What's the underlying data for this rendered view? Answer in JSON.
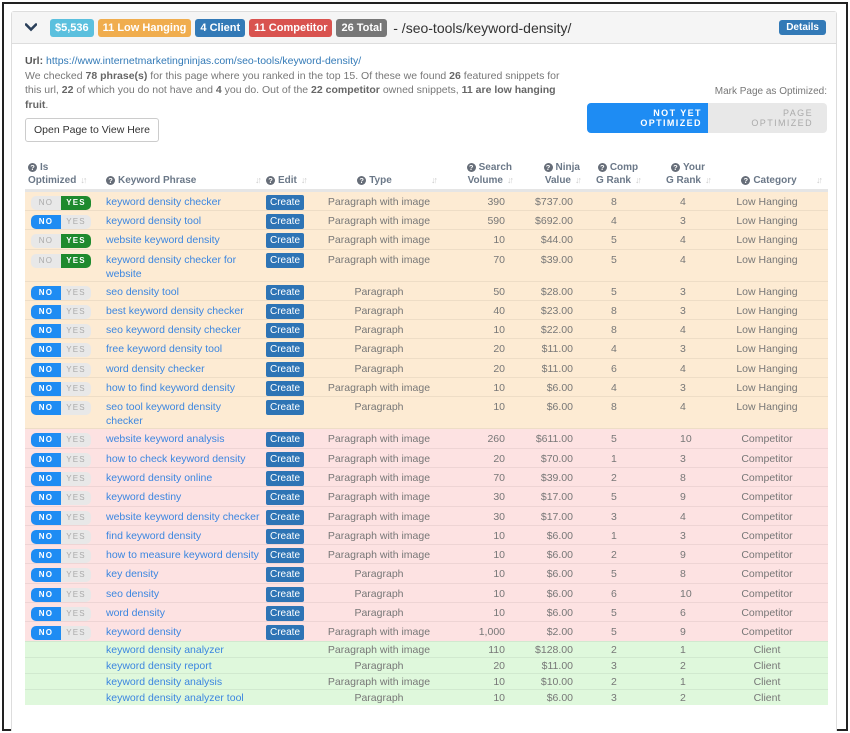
{
  "header": {
    "badges": {
      "value": "$5,536",
      "low_hanging": "11 Low Hanging",
      "client": "4 Client",
      "competitor": "11 Competitor",
      "total": "26 Total"
    },
    "path": "- /seo-tools/keyword-density/",
    "details_label": "Details"
  },
  "info": {
    "url_label": "Url:",
    "url": "https://www.internetmarketingninjas.com/seo-tools/keyword-density/",
    "text_1": "We checked ",
    "phrases": "78 phrase(s)",
    "text_2": " for this page where you ranked in the top 15. Of these we found ",
    "found": "26",
    "text_3": " featured snippets for this url, ",
    "not_have": "22",
    "text_4": " of which you do not have and ",
    "have": "4",
    "text_5": " you do. Out of the ",
    "competitor": "22 competitor",
    "text_6": " owned snippets, ",
    "low": "11 are low hanging fruit",
    "text_7": ".",
    "open_button": "Open Page to View Here"
  },
  "mark": {
    "label": "Mark Page as Optimized:",
    "not_yet": "NOT YET OPTIMIZED",
    "optimized": "PAGE OPTIMIZED",
    "selected": "NOT YET OPTIMIZED"
  },
  "table": {
    "headers": {
      "optimized_1": "Is",
      "optimized_2": "Optimized",
      "phrase": "Keyword Phrase",
      "edit": "Edit",
      "type": "Type",
      "volume_1": "Search",
      "volume_2": "Volume",
      "value_1": "Ninja",
      "value_2": "Value",
      "comp_1": "Comp",
      "comp_2": "G Rank",
      "your_1": "Your",
      "your_2": "G Rank",
      "category": "Category"
    },
    "toggle_labels": {
      "no": "NO",
      "yes": "YES"
    },
    "create_label": "Create",
    "rows": [
      {
        "opt": "yes",
        "phrase": "keyword density checker",
        "type": "Paragraph with image",
        "volume": "390",
        "value": "$737.00",
        "comp": "8",
        "your": "4",
        "category": "Low Hanging",
        "group": "low"
      },
      {
        "opt": "no",
        "phrase": "keyword density tool",
        "type": "Paragraph with image",
        "volume": "590",
        "value": "$692.00",
        "comp": "4",
        "your": "3",
        "category": "Low Hanging",
        "group": "low"
      },
      {
        "opt": "yes",
        "phrase": "website keyword density",
        "type": "Paragraph with image",
        "volume": "10",
        "value": "$44.00",
        "comp": "5",
        "your": "4",
        "category": "Low Hanging",
        "group": "low"
      },
      {
        "opt": "yes",
        "phrase": "keyword density checker for website",
        "type": "Paragraph with image",
        "volume": "70",
        "value": "$39.00",
        "comp": "5",
        "your": "4",
        "category": "Low Hanging",
        "group": "low"
      },
      {
        "opt": "no",
        "phrase": "seo density tool",
        "type": "Paragraph",
        "volume": "50",
        "value": "$28.00",
        "comp": "5",
        "your": "3",
        "category": "Low Hanging",
        "group": "low"
      },
      {
        "opt": "no",
        "phrase": "best keyword density checker",
        "type": "Paragraph",
        "volume": "40",
        "value": "$23.00",
        "comp": "8",
        "your": "3",
        "category": "Low Hanging",
        "group": "low"
      },
      {
        "opt": "no",
        "phrase": "seo keyword density checker",
        "type": "Paragraph",
        "volume": "10",
        "value": "$22.00",
        "comp": "8",
        "your": "4",
        "category": "Low Hanging",
        "group": "low"
      },
      {
        "opt": "no",
        "phrase": "free keyword density tool",
        "type": "Paragraph",
        "volume": "20",
        "value": "$11.00",
        "comp": "4",
        "your": "3",
        "category": "Low Hanging",
        "group": "low"
      },
      {
        "opt": "no",
        "phrase": "word density checker",
        "type": "Paragraph",
        "volume": "20",
        "value": "$11.00",
        "comp": "6",
        "your": "4",
        "category": "Low Hanging",
        "group": "low"
      },
      {
        "opt": "no",
        "phrase": "how to find keyword density",
        "type": "Paragraph with image",
        "volume": "10",
        "value": "$6.00",
        "comp": "4",
        "your": "3",
        "category": "Low Hanging",
        "group": "low"
      },
      {
        "opt": "no",
        "phrase": "seo tool keyword density checker",
        "type": "Paragraph",
        "volume": "10",
        "value": "$6.00",
        "comp": "8",
        "your": "4",
        "category": "Low Hanging",
        "group": "low"
      },
      {
        "opt": "no",
        "phrase": "website keyword analysis",
        "type": "Paragraph with image",
        "volume": "260",
        "value": "$611.00",
        "comp": "5",
        "your": "10",
        "category": "Competitor",
        "group": "comp"
      },
      {
        "opt": "no",
        "phrase": "how to check keyword density",
        "type": "Paragraph with image",
        "volume": "20",
        "value": "$70.00",
        "comp": "1",
        "your": "3",
        "category": "Competitor",
        "group": "comp"
      },
      {
        "opt": "no",
        "phrase": "keyword density online",
        "type": "Paragraph with image",
        "volume": "70",
        "value": "$39.00",
        "comp": "2",
        "your": "8",
        "category": "Competitor",
        "group": "comp"
      },
      {
        "opt": "no",
        "phrase": "keyword destiny",
        "type": "Paragraph with image",
        "volume": "30",
        "value": "$17.00",
        "comp": "5",
        "your": "9",
        "category": "Competitor",
        "group": "comp"
      },
      {
        "opt": "no",
        "phrase": "website keyword density checker",
        "type": "Paragraph with image",
        "volume": "30",
        "value": "$17.00",
        "comp": "3",
        "your": "4",
        "category": "Competitor",
        "group": "comp"
      },
      {
        "opt": "no",
        "phrase": "find keyword density",
        "type": "Paragraph with image",
        "volume": "10",
        "value": "$6.00",
        "comp": "1",
        "your": "3",
        "category": "Competitor",
        "group": "comp"
      },
      {
        "opt": "no",
        "phrase": "how to measure keyword density",
        "type": "Paragraph with image",
        "volume": "10",
        "value": "$6.00",
        "comp": "2",
        "your": "9",
        "category": "Competitor",
        "group": "comp"
      },
      {
        "opt": "no",
        "phrase": "key density",
        "type": "Paragraph",
        "volume": "10",
        "value": "$6.00",
        "comp": "5",
        "your": "8",
        "category": "Competitor",
        "group": "comp"
      },
      {
        "opt": "no",
        "phrase": "seo density",
        "type": "Paragraph",
        "volume": "10",
        "value": "$6.00",
        "comp": "6",
        "your": "10",
        "category": "Competitor",
        "group": "comp"
      },
      {
        "opt": "no",
        "phrase": "word density",
        "type": "Paragraph",
        "volume": "10",
        "value": "$6.00",
        "comp": "5",
        "your": "6",
        "category": "Competitor",
        "group": "comp"
      },
      {
        "opt": "no",
        "phrase": "keyword density",
        "type": "Paragraph with image",
        "volume": "1,000",
        "value": "$2.00",
        "comp": "5",
        "your": "9",
        "category": "Competitor",
        "group": "comp"
      },
      {
        "opt": "",
        "phrase": "keyword density analyzer",
        "type": "Paragraph with image",
        "volume": "110",
        "value": "$128.00",
        "comp": "2",
        "your": "1",
        "category": "Client",
        "group": "client"
      },
      {
        "opt": "",
        "phrase": "keyword density report",
        "type": "Paragraph",
        "volume": "20",
        "value": "$11.00",
        "comp": "3",
        "your": "2",
        "category": "Client",
        "group": "client"
      },
      {
        "opt": "",
        "phrase": "keyword density analysis",
        "type": "Paragraph with image",
        "volume": "10",
        "value": "$10.00",
        "comp": "2",
        "your": "1",
        "category": "Client",
        "group": "client"
      },
      {
        "opt": "",
        "phrase": "keyword density analyzer tool",
        "type": "Paragraph",
        "volume": "10",
        "value": "$6.00",
        "comp": "3",
        "your": "2",
        "category": "Client",
        "group": "client"
      }
    ]
  },
  "colors": {
    "low_hanging_row": "#fdebd3",
    "competitor_row": "#fde2e2",
    "client_row": "#dff8dc",
    "toggle_no_active": "#1e8cf3",
    "toggle_yes_active": "#1f8a2e",
    "link": "#3b86e0",
    "create_button": "#2e74b5"
  }
}
